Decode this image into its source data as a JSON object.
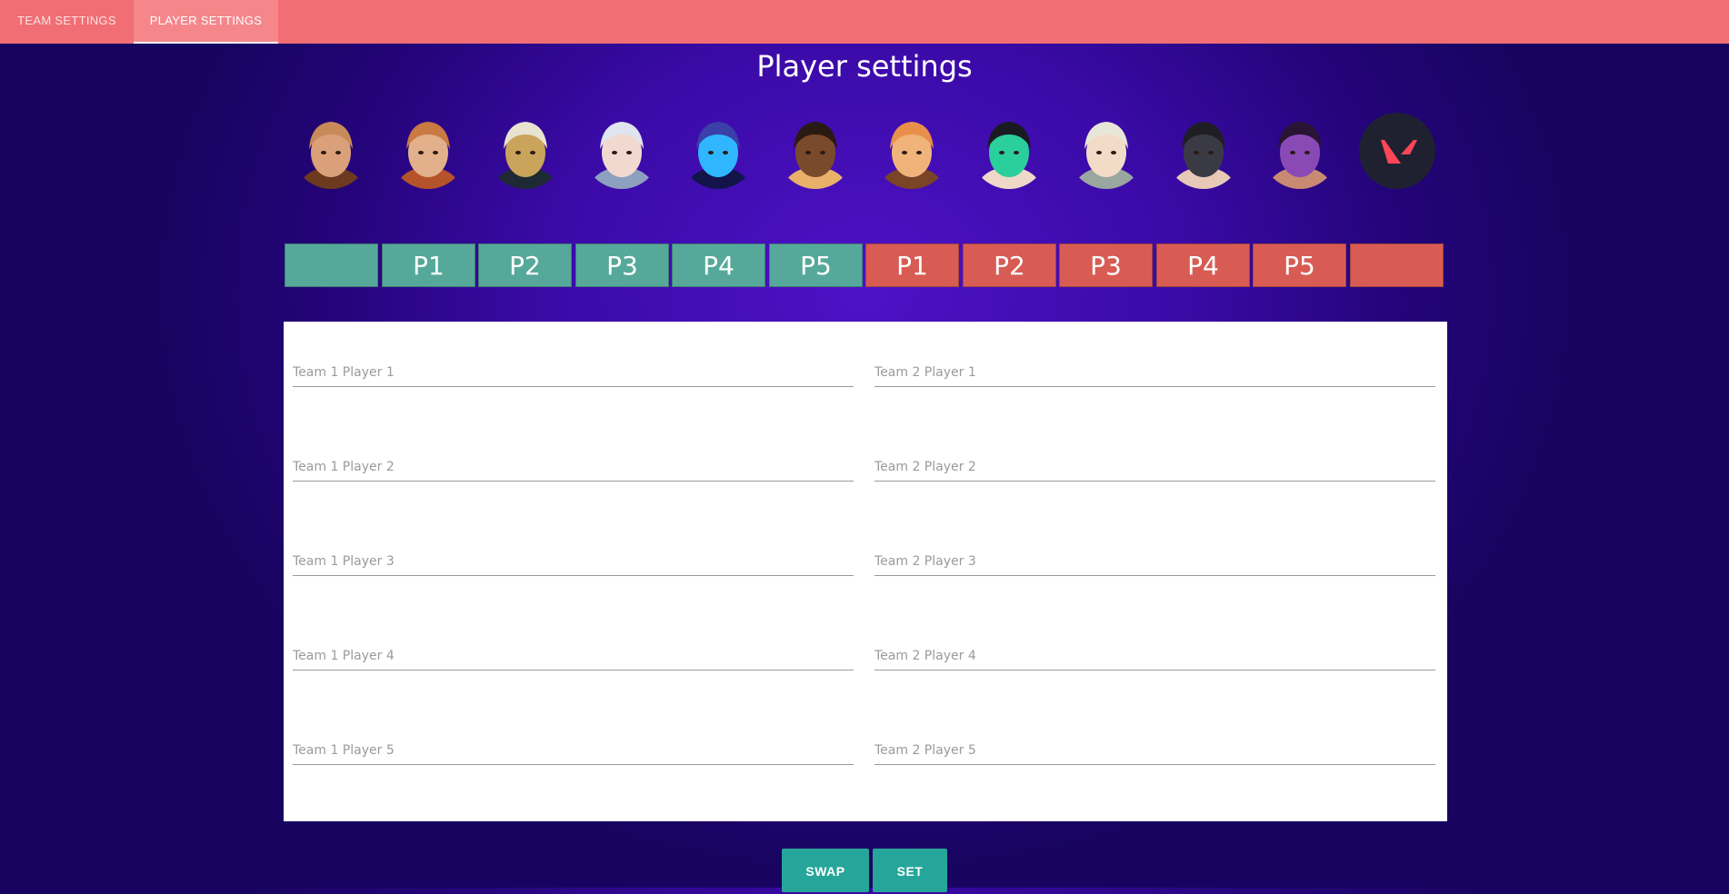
{
  "tabs": [
    {
      "label": "TEAM SETTINGS",
      "active": false
    },
    {
      "label": "PLAYER SETTINGS",
      "active": true
    }
  ],
  "page_title": "Player settings",
  "agents": [
    {
      "name": "brimstone-portrait",
      "colors": [
        "#c98a5a",
        "#6b3a1f",
        "#d9a07a"
      ]
    },
    {
      "name": "brimstone-alt-portrait",
      "colors": [
        "#c97a42",
        "#b5532a",
        "#e2b08a"
      ]
    },
    {
      "name": "cypher-portrait",
      "colors": [
        "#e8e2d0",
        "#1e2a33",
        "#c9a45a"
      ]
    },
    {
      "name": "jett-portrait",
      "colors": [
        "#dfe4ee",
        "#8ea0bf",
        "#f2d9cf"
      ]
    },
    {
      "name": "omen-portrait",
      "colors": [
        "#3b3fa8",
        "#12144a",
        "#2fb6ff"
      ]
    },
    {
      "name": "phoenix-portrait",
      "colors": [
        "#2a1a14",
        "#e9b06a",
        "#7a4a2c"
      ]
    },
    {
      "name": "raze-portrait",
      "colors": [
        "#e8904a",
        "#7a4426",
        "#f0b47a"
      ]
    },
    {
      "name": "sage-portrait",
      "colors": [
        "#1a1a22",
        "#f0d8c8",
        "#2bcf9c"
      ]
    },
    {
      "name": "sova-portrait",
      "colors": [
        "#e8e6d8",
        "#9aa6a0",
        "#f2dcc8"
      ]
    },
    {
      "name": "viper-portrait",
      "colors": [
        "#1e1e24",
        "#e8c8b6",
        "#3a3a44"
      ]
    },
    {
      "name": "reyna-portrait",
      "colors": [
        "#2a1434",
        "#c88a72",
        "#8a4ab6"
      ]
    },
    {
      "name": "valorant-logo",
      "colors": [
        "#1f2130",
        "#ff4655",
        "#ff4655"
      ]
    }
  ],
  "slots": [
    {
      "label": "",
      "team": 1
    },
    {
      "label": "P1",
      "team": 1
    },
    {
      "label": "P2",
      "team": 1
    },
    {
      "label": "P3",
      "team": 1
    },
    {
      "label": "P4",
      "team": 1
    },
    {
      "label": "P5",
      "team": 1
    },
    {
      "label": "P1",
      "team": 2
    },
    {
      "label": "P2",
      "team": 2
    },
    {
      "label": "P3",
      "team": 2
    },
    {
      "label": "P4",
      "team": 2
    },
    {
      "label": "P5",
      "team": 2
    },
    {
      "label": "",
      "team": 2
    }
  ],
  "team1_fields": [
    {
      "placeholder": "Team 1 Player 1",
      "value": ""
    },
    {
      "placeholder": "Team 1 Player 2",
      "value": ""
    },
    {
      "placeholder": "Team 1 Player 3",
      "value": ""
    },
    {
      "placeholder": "Team 1 Player 4",
      "value": ""
    },
    {
      "placeholder": "Team 1 Player 5",
      "value": ""
    }
  ],
  "team2_fields": [
    {
      "placeholder": "Team 2 Player 1",
      "value": ""
    },
    {
      "placeholder": "Team 2 Player 2",
      "value": ""
    },
    {
      "placeholder": "Team 2 Player 3",
      "value": ""
    },
    {
      "placeholder": "Team 2 Player 4",
      "value": ""
    },
    {
      "placeholder": "Team 2 Player 5",
      "value": ""
    }
  ],
  "buttons": {
    "swap": "SWAP",
    "set": "SET"
  }
}
